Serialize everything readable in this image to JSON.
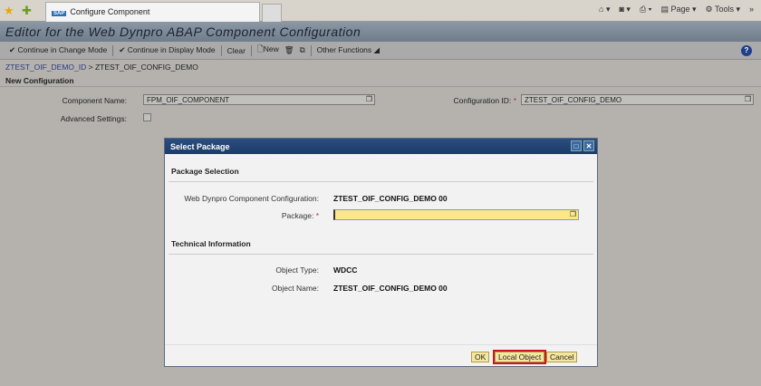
{
  "browser": {
    "tab_title": "Configure Component",
    "sap_logo": "SAP",
    "tools": [
      "Page",
      "Tools"
    ],
    "icons": [
      "favorites-star-icon",
      "add-favorites-icon",
      "home-icon",
      "feeds-icon",
      "print-icon",
      "page-icon",
      "tools-gear-icon"
    ]
  },
  "header": {
    "title": "Editor for the Web Dynpro ABAP Component Configuration"
  },
  "toolbar": {
    "change_mode": "Continue in Change Mode",
    "display_mode": "Continue in Display Mode",
    "clear": "Clear",
    "new": "New",
    "other": "Other Functions"
  },
  "breadcrumb": {
    "link": "ZTEST_OIF_DEMO_ID",
    "separator": ">",
    "current": "ZTEST_OIF_CONFIG_DEMO"
  },
  "form": {
    "section": "New Configuration",
    "component_label": "Component Name:",
    "component_value": "FPM_OIF_COMPONENT",
    "config_label": "Configuration ID:",
    "config_value": "ZTEST_OIF_CONFIG_DEMO",
    "advanced_label": "Advanced Settings:",
    "required": "*"
  },
  "dialog": {
    "title": "Select Package",
    "section1": "Package Selection",
    "wdcc_label": "Web Dynpro Component Configuration:",
    "wdcc_value": "ZTEST_OIF_CONFIG_DEMO 00",
    "package_label": "Package:",
    "package_value": "",
    "section2": "Technical Information",
    "type_label": "Object Type:",
    "type_value": "WDCC",
    "name_label": "Object Name:",
    "name_value": "ZTEST_OIF_CONFIG_DEMO 00",
    "ok": "OK",
    "local": "Local Object",
    "cancel": "Cancel"
  }
}
